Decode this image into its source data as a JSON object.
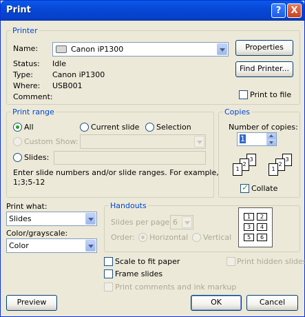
{
  "window": {
    "title": "Print",
    "help_glyph": "?",
    "close_glyph": "X"
  },
  "printer": {
    "legend": "Printer",
    "name_label": "Name:",
    "name_value": "Canon iP1300",
    "status_label": "Status:",
    "status_value": "Idle",
    "type_label": "Type:",
    "type_value": "Canon iP1300",
    "where_label": "Where:",
    "where_value": "USB001",
    "comment_label": "Comment:",
    "comment_value": "",
    "properties_button": "Properties",
    "find_printer_button": "Find Printer...",
    "print_to_file_label": "Print to file"
  },
  "print_range": {
    "legend": "Print range",
    "all_label": "All",
    "current_slide_label": "Current slide",
    "selection_label": "Selection",
    "custom_show_label": "Custom Show:",
    "slides_label": "Slides:",
    "slides_value": "",
    "help_text_line1": "Enter slide numbers and/or slide ranges. For example,",
    "help_text_line2": "1;3;5-12"
  },
  "copies": {
    "legend": "Copies",
    "number_label": "Number of copies:",
    "number_value": "1",
    "collate_label": "Collate",
    "page_labels": [
      "1",
      "2",
      "3"
    ]
  },
  "print_what": {
    "label": "Print what:",
    "value": "Slides"
  },
  "color_grayscale": {
    "label": "Color/grayscale:",
    "value": "Color"
  },
  "handouts": {
    "legend": "Handouts",
    "slides_per_page_label": "Slides per page:",
    "slides_per_page_value": "6",
    "order_label": "Order:",
    "horizontal_label": "Horizontal",
    "vertical_label": "Vertical",
    "preview_cells": [
      "1",
      "2",
      "3",
      "4",
      "5",
      "6"
    ]
  },
  "options": {
    "scale_to_fit_label": "Scale to fit paper",
    "frame_slides_label": "Frame slides",
    "print_comments_label": "Print comments and ink markup",
    "print_hidden_label": "Print hidden slides"
  },
  "buttons": {
    "preview": "Preview",
    "ok": "OK",
    "cancel": "Cancel"
  }
}
